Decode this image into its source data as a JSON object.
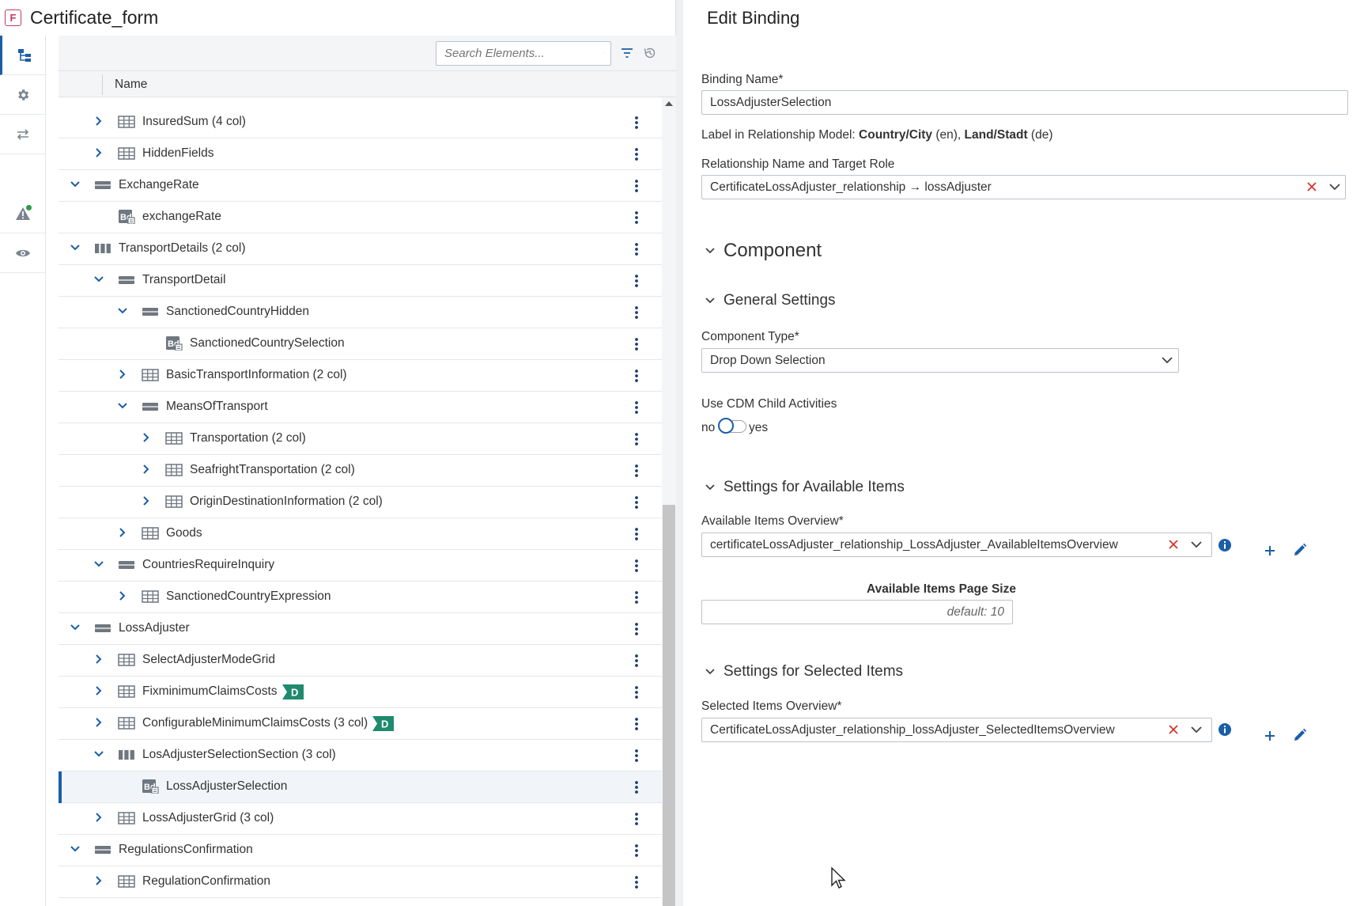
{
  "app": {
    "badge": "F",
    "form_title": "Certificate_form"
  },
  "side_nav": [
    {
      "name": "structure-icon",
      "active": true
    },
    {
      "name": "settings-gear-icon",
      "active": false
    },
    {
      "name": "transfer-arrows-icon",
      "active": false
    },
    {
      "name": "warning-icon",
      "active": false
    },
    {
      "name": "preview-eye-icon",
      "active": false
    }
  ],
  "toolbar": {
    "search_placeholder": "Search Elements..."
  },
  "tree": {
    "column_name": "Name",
    "rows": [
      {
        "label": "InsuredSum (4 col)",
        "indent": 2,
        "toggle": "collapsed",
        "icon": "grid"
      },
      {
        "label": "HiddenFields",
        "indent": 2,
        "toggle": "collapsed",
        "icon": "grid"
      },
      {
        "label": "ExchangeRate",
        "indent": 1,
        "toggle": "expanded",
        "icon": "section"
      },
      {
        "label": "exchangeRate",
        "indent": 2,
        "toggle": "none",
        "icon": "binding"
      },
      {
        "label": "TransportDetails (2 col)",
        "indent": 1,
        "toggle": "expanded",
        "icon": "columns"
      },
      {
        "label": "TransportDetail",
        "indent": 2,
        "toggle": "expanded",
        "icon": "section"
      },
      {
        "label": "SanctionedCountryHidden",
        "indent": 3,
        "toggle": "expanded",
        "icon": "section"
      },
      {
        "label": "SanctionedCountrySelection",
        "indent": 4,
        "toggle": "none",
        "icon": "binding"
      },
      {
        "label": "BasicTransportInformation (2 col)",
        "indent": 3,
        "toggle": "collapsed",
        "icon": "grid"
      },
      {
        "label": "MeansOfTransport",
        "indent": 3,
        "toggle": "expanded",
        "icon": "section"
      },
      {
        "label": "Transportation (2 col)",
        "indent": 4,
        "toggle": "collapsed",
        "icon": "grid"
      },
      {
        "label": "SeafrightTransportation (2 col)",
        "indent": 4,
        "toggle": "collapsed",
        "icon": "grid"
      },
      {
        "label": "OriginDestinationInformation (2 col)",
        "indent": 4,
        "toggle": "collapsed",
        "icon": "grid"
      },
      {
        "label": "Goods",
        "indent": 3,
        "toggle": "collapsed",
        "icon": "grid"
      },
      {
        "label": "CountriesRequireInquiry",
        "indent": 2,
        "toggle": "expanded",
        "icon": "section"
      },
      {
        "label": "SanctionedCountryExpression",
        "indent": 3,
        "toggle": "collapsed",
        "icon": "grid"
      },
      {
        "label": "LossAdjuster",
        "indent": 1,
        "toggle": "expanded",
        "icon": "section"
      },
      {
        "label": "SelectAdjusterModeGrid",
        "indent": 2,
        "toggle": "collapsed",
        "icon": "grid"
      },
      {
        "label": "FixminimumClaimsCosts",
        "indent": 2,
        "toggle": "collapsed",
        "icon": "grid",
        "badge": "D"
      },
      {
        "label": "ConfigurableMinimumClaimsCosts (3 col)",
        "indent": 2,
        "toggle": "collapsed",
        "icon": "grid",
        "badge": "D"
      },
      {
        "label": "LosAdjusterSelectionSection (3 col)",
        "indent": 2,
        "toggle": "expanded",
        "icon": "columns"
      },
      {
        "label": "LossAdjusterSelection",
        "indent": 3,
        "toggle": "none",
        "icon": "binding",
        "selected": true
      },
      {
        "label": "LossAdjusterGrid (3 col)",
        "indent": 2,
        "toggle": "collapsed",
        "icon": "grid"
      },
      {
        "label": "RegulationsConfirmation",
        "indent": 1,
        "toggle": "expanded",
        "icon": "section"
      },
      {
        "label": "RegulationConfirmation",
        "indent": 2,
        "toggle": "collapsed",
        "icon": "grid"
      }
    ]
  },
  "edit_binding": {
    "title": "Edit Binding",
    "binding_name_label": "Binding Name*",
    "binding_name_value": "LossAdjusterSelection",
    "relationship_label": {
      "prefix": "Label in Relationship Model: ",
      "en_value": "Country/City",
      "en_suffix": " (en), ",
      "de_value": "Land/Stadt",
      "de_suffix": " (de)"
    },
    "relationship_name_label": "Relationship Name and Target Role",
    "relationship_name_value": "CertificateLossAdjuster_relationship → lossAdjuster",
    "component_section": "Component",
    "general_settings_section": "General Settings",
    "component_type_label": "Component Type*",
    "component_type_value": "Drop Down Selection",
    "use_cdm_label": "Use CDM Child Activities",
    "toggle": {
      "off_label": "no",
      "on_label": "yes",
      "value": false
    },
    "available_section": "Settings for Available Items",
    "available_overview_label": "Available Items Overview*",
    "available_overview_value": "certificateLossAdjuster_relationship_LossAdjuster_AvailableItemsOverview",
    "page_size_label": "Available Items Page Size",
    "page_size_placeholder": "default: 10",
    "selected_section": "Settings for Selected Items",
    "selected_overview_label": "Selected Items Overview*",
    "selected_overview_value": "CertificateLossAdjuster_relationship_lossAdjuster_SelectedItemsOverview"
  },
  "colors": {
    "accent": "#1b5ea8",
    "clear_x": "#d9342b",
    "badge_green": "#1f8a6e",
    "selection_bar": "#1b5ea8"
  }
}
